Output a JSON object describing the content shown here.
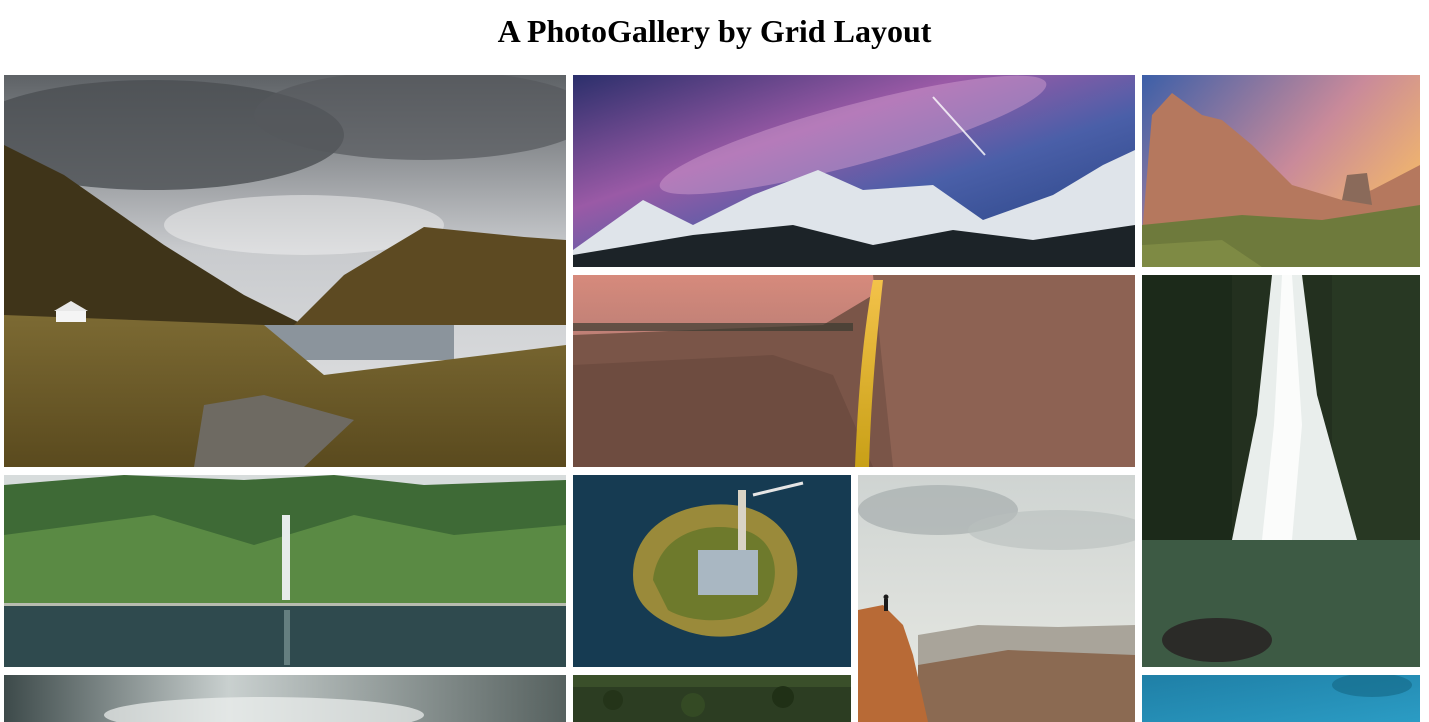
{
  "page": {
    "title": "A PhotoGallery by Grid Layout"
  },
  "gallery": {
    "photos": [
      {
        "id": "valley-lake-church"
      },
      {
        "id": "milky-way-mountains"
      },
      {
        "id": "dolomites-sunset"
      },
      {
        "id": "firefall-cliff"
      },
      {
        "id": "forest-waterfall"
      },
      {
        "id": "green-fjord-waterfall"
      },
      {
        "id": "aerial-island-cabin"
      },
      {
        "id": "canyon-hiker"
      },
      {
        "id": "stormy-coast"
      },
      {
        "id": "aerial-forest"
      },
      {
        "id": "blue-water"
      }
    ]
  }
}
